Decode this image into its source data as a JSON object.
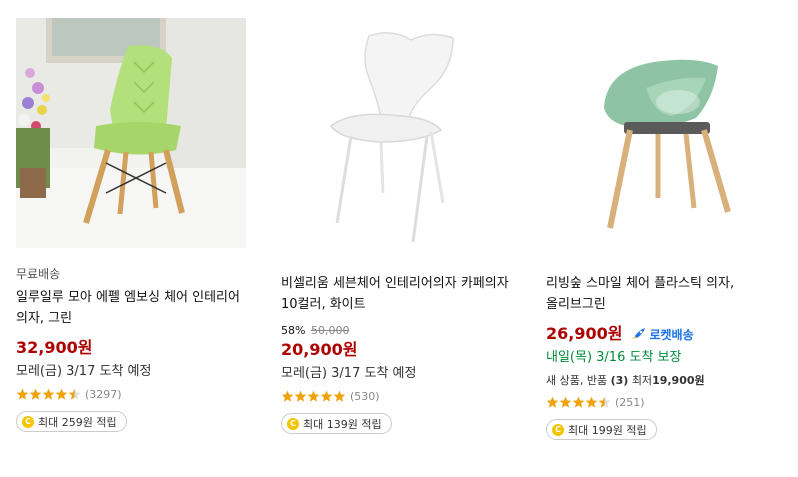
{
  "products": [
    {
      "badge_free_shipping": "무료배송",
      "name": "일루일루 모아 에펠 엠보싱 체어 인테리어 의자, 그린",
      "price": "32,900원",
      "delivery": "모레(금) 3/17 도착 예정",
      "rating": 4.5,
      "review_count": "(3297)",
      "reward": "최대 259원 적립"
    },
    {
      "discount_rate": "58%",
      "original_price": "50,000",
      "name": "비셀리움 세븐체어 인테리어의자 카페의자 10컬러, 화이트",
      "price": "20,900원",
      "delivery": "모레(금) 3/17 도착 예정",
      "rating": 5,
      "review_count": "(530)",
      "reward": "최대 139원 적립"
    },
    {
      "name": "리빙숲 스마일 체어 플라스틱 의자, 올리브그린",
      "price": "26,900원",
      "rocket_label": "로켓배송",
      "delivery": "내일(목) 3/16 도착 보장",
      "extra_prefix": "새 상품, 반품",
      "extra_count": "(3)",
      "extra_min_label": "최저",
      "extra_min_price": "19,900원",
      "rating": 4.5,
      "review_count": "(251)",
      "reward": "최대 199원 적립"
    }
  ],
  "colors": {
    "price": "#ae0000",
    "star": "#f0a20b",
    "rocket": "#1a73e8",
    "delivery_guarantee": "#008c3a",
    "coin": "#f5c400"
  }
}
